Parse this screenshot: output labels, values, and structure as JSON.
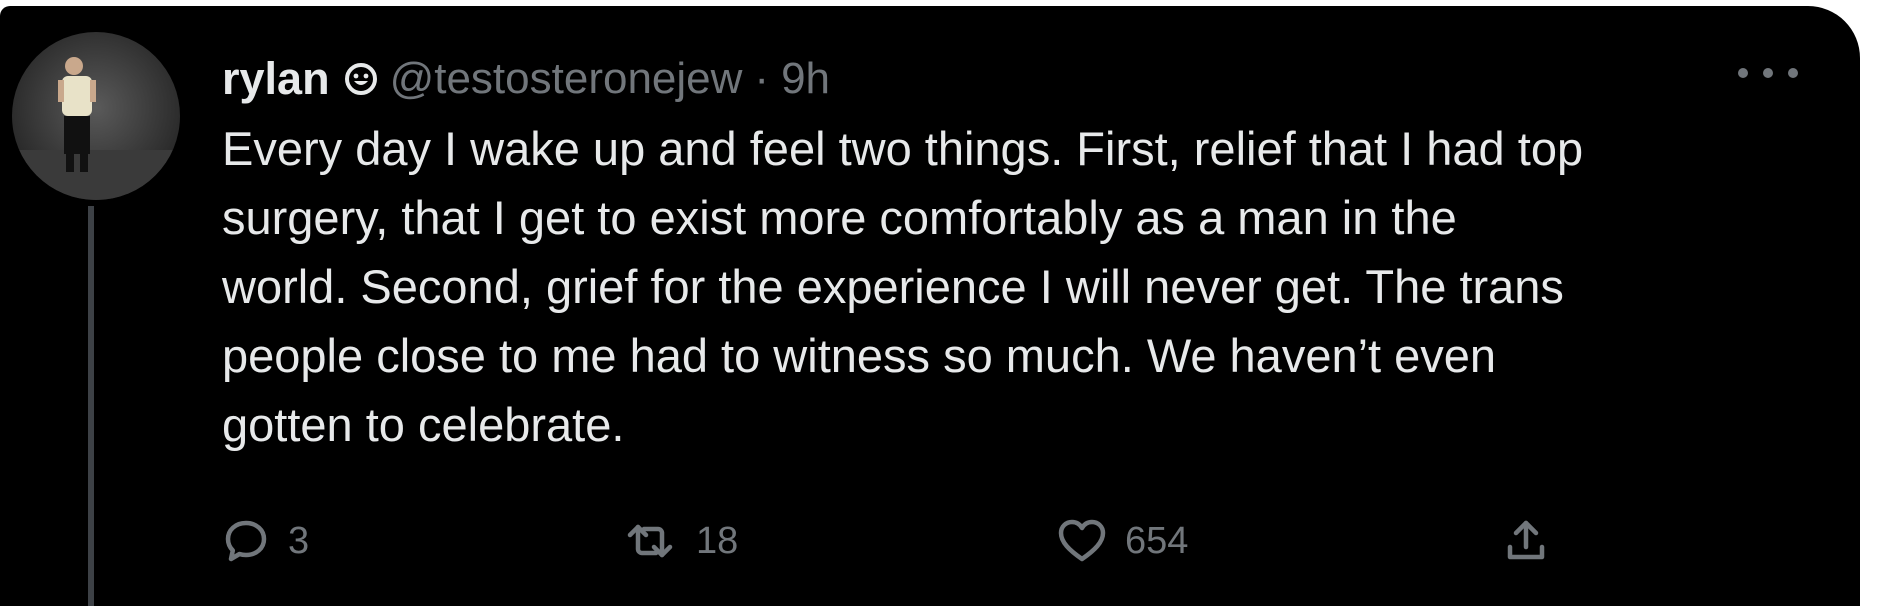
{
  "tweet": {
    "display_name": "rylan",
    "handle": "@testosteronejew",
    "separator": "·",
    "time": "9h",
    "text_lines": [
      "Every day I wake up and feel two things. First, relief that I had top",
      "surgery, that I get to exist more comfortably as a man in the",
      "world. Second, grief for the experience I will never get. The trans",
      "people close to me had to witness so much. We haven’t even",
      "gotten to celebrate."
    ],
    "replies": "3",
    "retweets": "18",
    "likes": "654"
  },
  "icons": {
    "avatar": "avatar-photo",
    "emoji": "smiley-icon",
    "more": "more-icon",
    "reply": "reply-icon",
    "retweet": "retweet-icon",
    "like": "heart-icon",
    "share": "share-icon"
  },
  "colors": {
    "background": "#000000",
    "primary_text": "#e7e9ea",
    "secondary_text": "#71767b"
  }
}
